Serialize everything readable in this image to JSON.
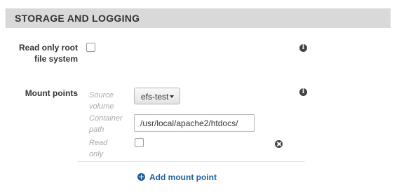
{
  "section": {
    "title": "STORAGE AND LOGGING"
  },
  "readonly_root": {
    "label_line1": "Read only root",
    "label_line2": "file system",
    "checked": false,
    "info_icon": "info-icon"
  },
  "mount_points": {
    "label": "Mount points",
    "info_icon": "info-icon",
    "source_volume_label_line1": "Source",
    "source_volume_label_line2": "volume",
    "source_volume_value": "efs-test",
    "container_path_label_line1": "Container",
    "container_path_label_line2": "path",
    "container_path_value": "/usr/local/apache2/htdocs/",
    "read_only_label_line1": "Read",
    "read_only_label_line2": "only",
    "read_only_checked": false,
    "remove_icon": "remove-icon",
    "add_label": "Add mount point",
    "add_icon": "plus-icon"
  },
  "colors": {
    "header_bg": "#d9d9d9",
    "link": "#1f5f9f",
    "muted_label": "#aaaaaa"
  }
}
